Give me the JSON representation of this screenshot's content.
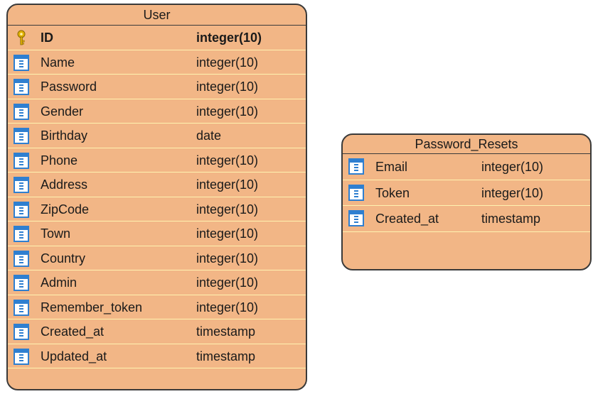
{
  "entities": [
    {
      "name": "User",
      "columns": [
        {
          "name": "ID",
          "type": "integer(10)",
          "primary_key": true,
          "icon": "key-icon"
        },
        {
          "name": "Name",
          "type": "integer(10)",
          "icon": "column-icon"
        },
        {
          "name": "Password",
          "type": "integer(10)",
          "icon": "column-icon"
        },
        {
          "name": "Gender",
          "type": "integer(10)",
          "icon": "column-icon"
        },
        {
          "name": "Birthday",
          "type": "date",
          "icon": "column-icon"
        },
        {
          "name": "Phone",
          "type": "integer(10)",
          "icon": "column-icon"
        },
        {
          "name": "Address",
          "type": "integer(10)",
          "icon": "column-icon"
        },
        {
          "name": "ZipCode",
          "type": "integer(10)",
          "icon": "column-icon"
        },
        {
          "name": "Town",
          "type": "integer(10)",
          "icon": "column-icon"
        },
        {
          "name": "Country",
          "type": "integer(10)",
          "icon": "column-icon"
        },
        {
          "name": "Admin",
          "type": "integer(10)",
          "icon": "column-icon"
        },
        {
          "name": "Remember_token",
          "type": "integer(10)",
          "icon": "column-icon"
        },
        {
          "name": "Created_at",
          "type": "timestamp",
          "icon": "column-icon"
        },
        {
          "name": "Updated_at",
          "type": "timestamp",
          "icon": "column-icon"
        }
      ]
    },
    {
      "name": "Password_Resets",
      "columns": [
        {
          "name": "Email",
          "type": "integer(10)",
          "icon": "column-icon"
        },
        {
          "name": "Token",
          "type": "integer(10)",
          "icon": "column-icon"
        },
        {
          "name": "Created_at",
          "type": "timestamp",
          "icon": "column-icon"
        }
      ]
    }
  ],
  "colors": {
    "entity_fill": "#f2b686",
    "entity_border": "#3a3a3a",
    "row_separator": "#fff3b0",
    "column_icon": "#2f7fd0",
    "key_icon": "#e0b000"
  }
}
